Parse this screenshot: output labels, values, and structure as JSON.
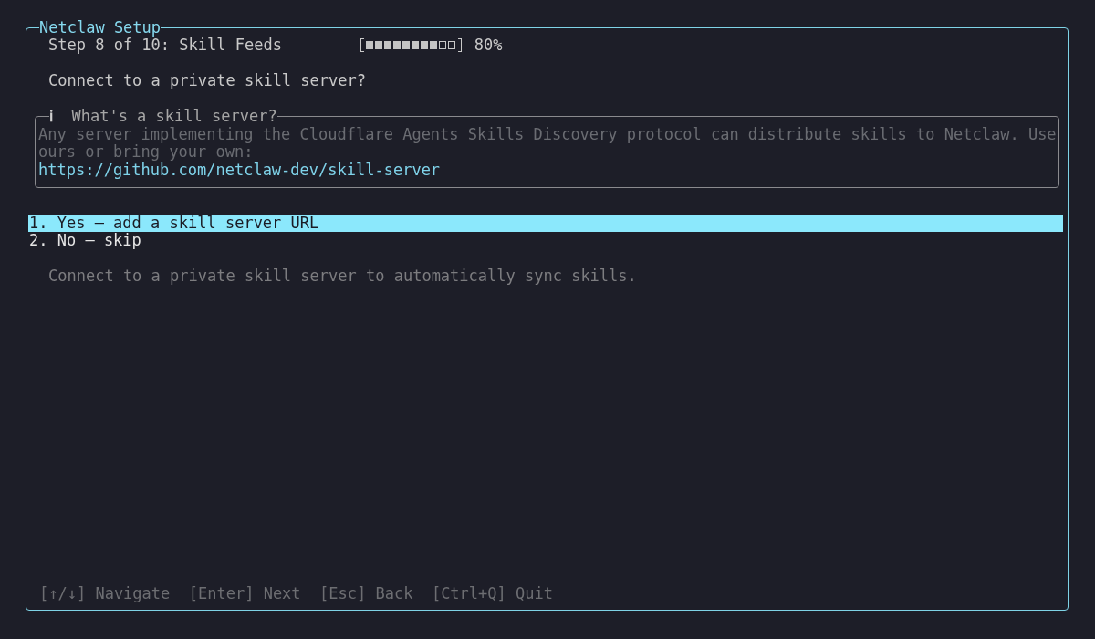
{
  "window": {
    "title": "Netclaw Setup"
  },
  "step": {
    "label": "Step 8 of 10: Skill Feeds"
  },
  "progress": {
    "level": 0.8,
    "reading": "80%"
  },
  "question": "Connect to a private skill server?",
  "info": {
    "icon": "ℹ",
    "title": "What's a skill server?",
    "text": "Any server implementing the Cloudflare Agents Skills Discovery protocol can distribute skills to Netclaw. Use ours or bring your own:",
    "link": "https://github.com/netclaw-dev/skill-server"
  },
  "options": [
    {
      "label": "1. Yes — add a skill server URL",
      "selected": true
    },
    {
      "label": "2. No — skip",
      "selected": false
    }
  ],
  "hint": "Connect to a private skill server to automatically sync skills.",
  "footer": {
    "hints": [
      "[↑/↓] Navigate",
      "[Enter] Next",
      "[Esc] Back",
      "[Ctrl+Q] Quit"
    ]
  }
}
